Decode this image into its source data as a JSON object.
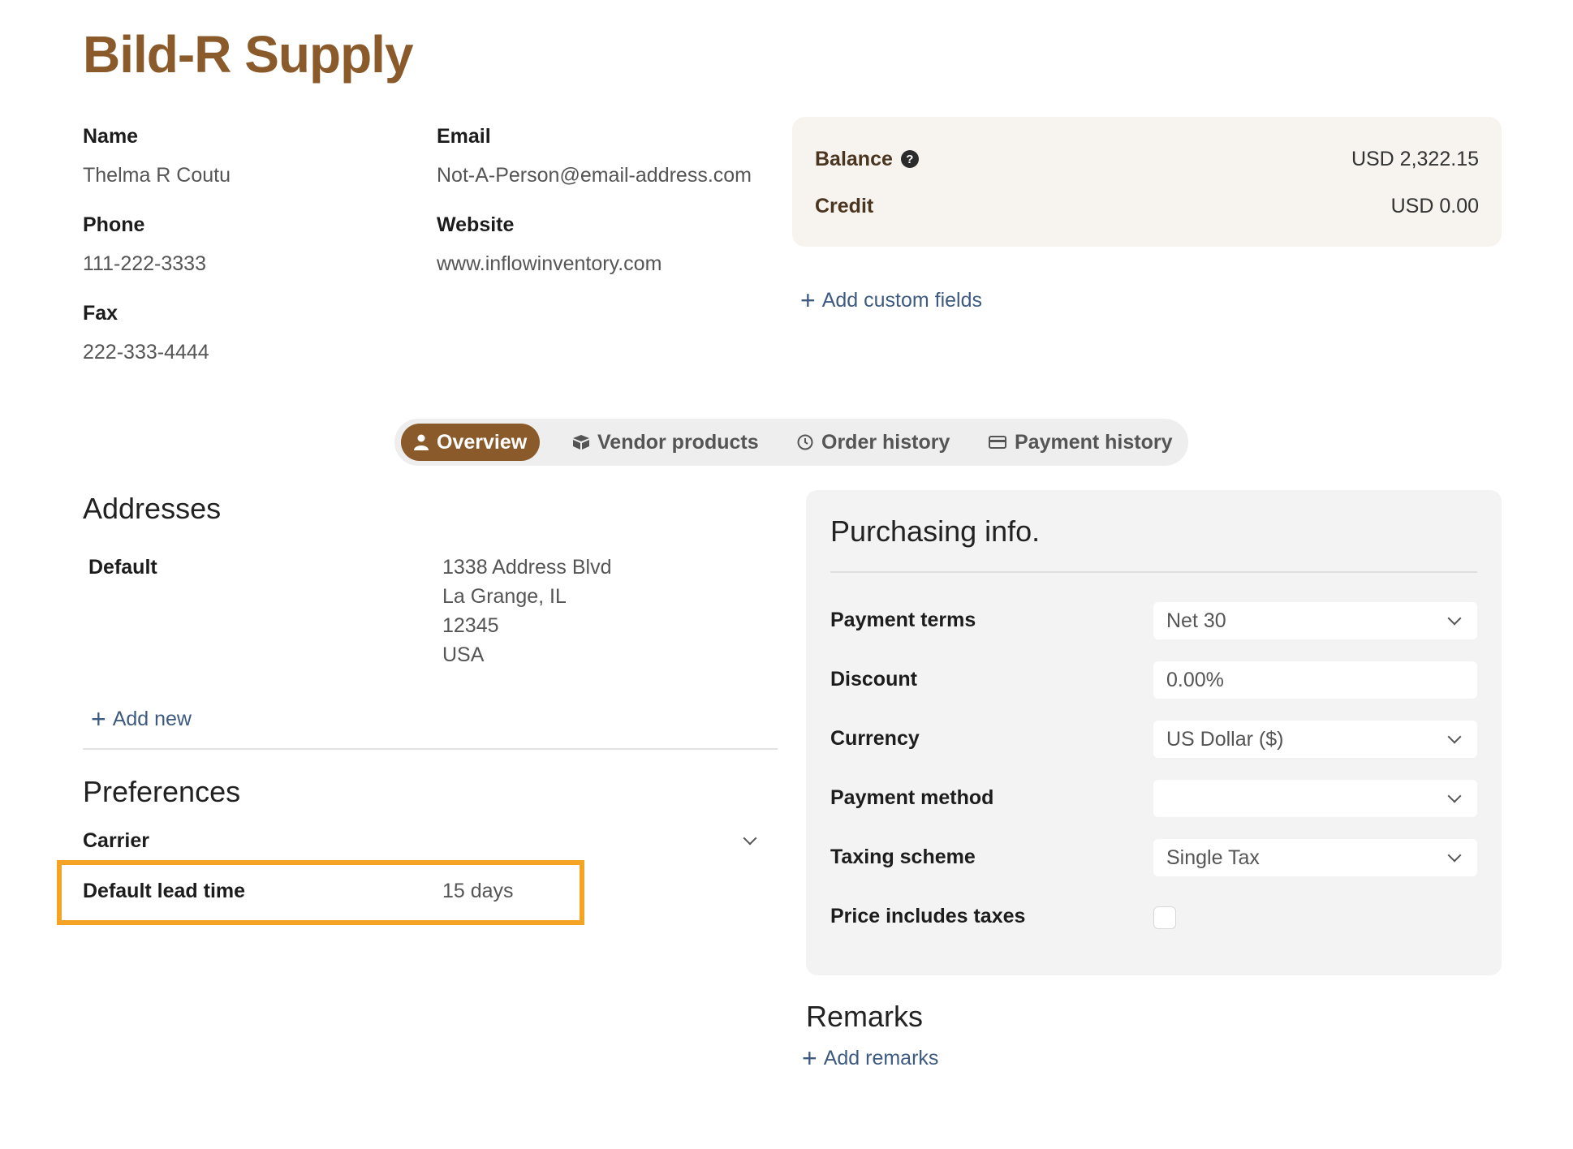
{
  "vendor_title": "Bild-R Supply",
  "contact": {
    "name_label": "Name",
    "name_value": "Thelma R Coutu",
    "email_label": "Email",
    "email_value": "Not-A-Person@email-address.com",
    "phone_label": "Phone",
    "phone_value": "111-222-3333",
    "website_label": "Website",
    "website_value": "www.inflowinventory.com",
    "fax_label": "Fax",
    "fax_value": "222-333-4444"
  },
  "balance": {
    "balance_label": "Balance",
    "balance_value": "USD 2,322.15",
    "credit_label": "Credit",
    "credit_value": "USD 0.00",
    "help_icon": "?"
  },
  "add_custom_fields": "Add custom fields",
  "tabs": [
    {
      "label": "Overview",
      "icon": "person-icon",
      "active": true
    },
    {
      "label": "Vendor products",
      "icon": "box-icon",
      "active": false
    },
    {
      "label": "Order history",
      "icon": "clock-icon",
      "active": false
    },
    {
      "label": "Payment history",
      "icon": "card-icon",
      "active": false
    }
  ],
  "addresses": {
    "title": "Addresses",
    "default_label": "Default",
    "lines": [
      "1338 Address Blvd",
      "La Grange, IL",
      "12345",
      "USA"
    ],
    "add_new": "Add new"
  },
  "preferences": {
    "title": "Preferences",
    "carrier_label": "Carrier",
    "lead_time_label": "Default lead time",
    "lead_time_value": "15 days"
  },
  "purchasing": {
    "title": "Purchasing info.",
    "payment_terms_label": "Payment terms",
    "payment_terms_value": "Net 30",
    "discount_label": "Discount",
    "discount_value": "0.00%",
    "currency_label": "Currency",
    "currency_value": "US Dollar ($)",
    "payment_method_label": "Payment method",
    "payment_method_value": "",
    "taxing_scheme_label": "Taxing scheme",
    "taxing_scheme_value": "Single Tax",
    "price_includes_taxes_label": "Price includes taxes",
    "price_includes_taxes_checked": false
  },
  "remarks": {
    "title": "Remarks",
    "add_remarks": "Add remarks"
  },
  "colors": {
    "brand": "#8b5a2b",
    "highlight": "#f4a324",
    "link": "#3d5a80"
  }
}
